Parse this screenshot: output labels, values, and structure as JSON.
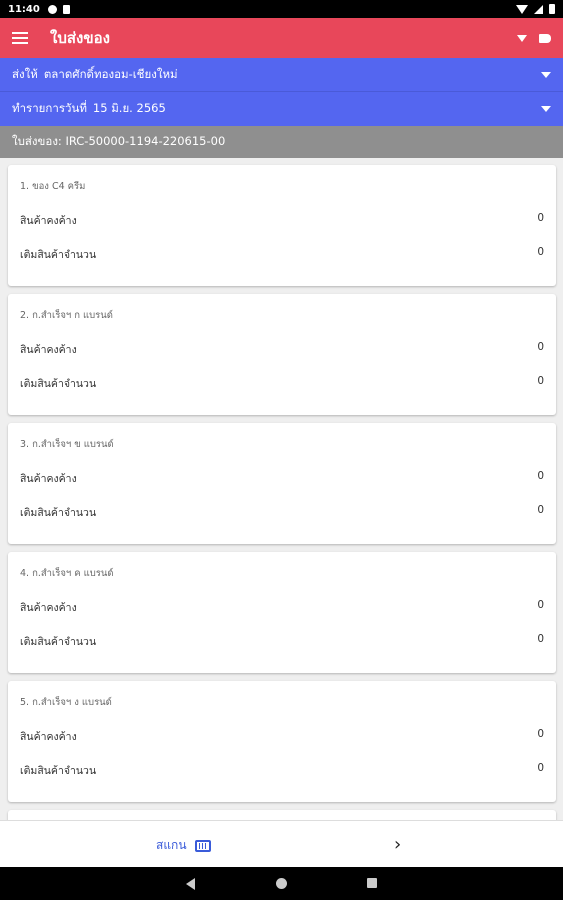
{
  "status": {
    "time": "11:40"
  },
  "appbar": {
    "title": "ใบส่งของ"
  },
  "selectors": [
    {
      "label": "ส่งให้",
      "value": "ตลาดศักดิ์ทองอม-เชียงใหม่"
    },
    {
      "label": "ทำรายการวันที่",
      "value": "15 มิ.ย. 2565"
    }
  ],
  "doc": {
    "number": "ใบส่งของ: IRC-50000-1194-220615-00"
  },
  "items": [
    {
      "title": "1. ของ C4 ครีม",
      "row1_label": "สินค้าคงค้าง",
      "row1_value": "0",
      "row2_label": "เติมสินค้าจำนวน",
      "row2_value": "0"
    },
    {
      "title": "2. ก.สำเร็จฯ ก แบรนด์",
      "row1_label": "สินค้าคงค้าง",
      "row1_value": "0",
      "row2_label": "เติมสินค้าจำนวน",
      "row2_value": "0"
    },
    {
      "title": "3. ก.สำเร็จฯ ข แบรนด์",
      "row1_label": "สินค้าคงค้าง",
      "row1_value": "0",
      "row2_label": "เติมสินค้าจำนวน",
      "row2_value": "0"
    },
    {
      "title": "4. ก.สำเร็จฯ ค แบรนด์",
      "row1_label": "สินค้าคงค้าง",
      "row1_value": "0",
      "row2_label": "เติมสินค้าจำนวน",
      "row2_value": "0"
    },
    {
      "title": "5. ก.สำเร็จฯ ง แบรนด์",
      "row1_label": "สินค้าคงค้าง",
      "row1_value": "0",
      "row2_label": "เติมสินค้าจำนวน",
      "row2_value": "0"
    }
  ],
  "bottom": {
    "scan_label": "สแกน",
    "next_glyph": "›"
  }
}
